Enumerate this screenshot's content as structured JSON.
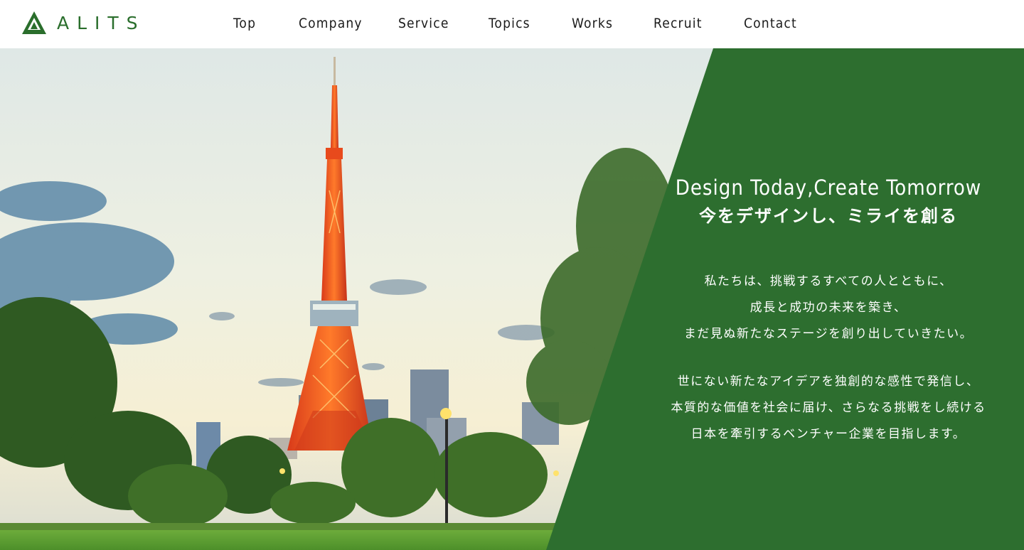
{
  "brand": {
    "name": "ALITS",
    "color": "#2a6e2c",
    "logo_icon": "triangle-a-logo-icon"
  },
  "nav": {
    "items": [
      {
        "label": "Top"
      },
      {
        "label": "Company"
      },
      {
        "label": "Service"
      },
      {
        "label": "Topics"
      },
      {
        "label": "Works"
      },
      {
        "label": "Recruit"
      },
      {
        "label": "Contact"
      }
    ]
  },
  "hero": {
    "title_en": "Design Today,Create Tomorrow",
    "title_ja": "今をデザインし、ミライを創る",
    "paragraph1": [
      "私たちは、挑戦するすべての人とともに、",
      "成長と成功の未来を築き、",
      "まだ見ぬ新たなステージを創り出していきたい。"
    ],
    "paragraph2": [
      "世にない新たなアイデアを独創的な感性で発信し、",
      "本質的な価値を社会に届け、さらなる挑戦をし続ける",
      "日本を牽引するベンチャー企業を目指します。"
    ],
    "panel_color": "#2d6e2f",
    "image_subject": "tokyo-tower-park-photo"
  }
}
